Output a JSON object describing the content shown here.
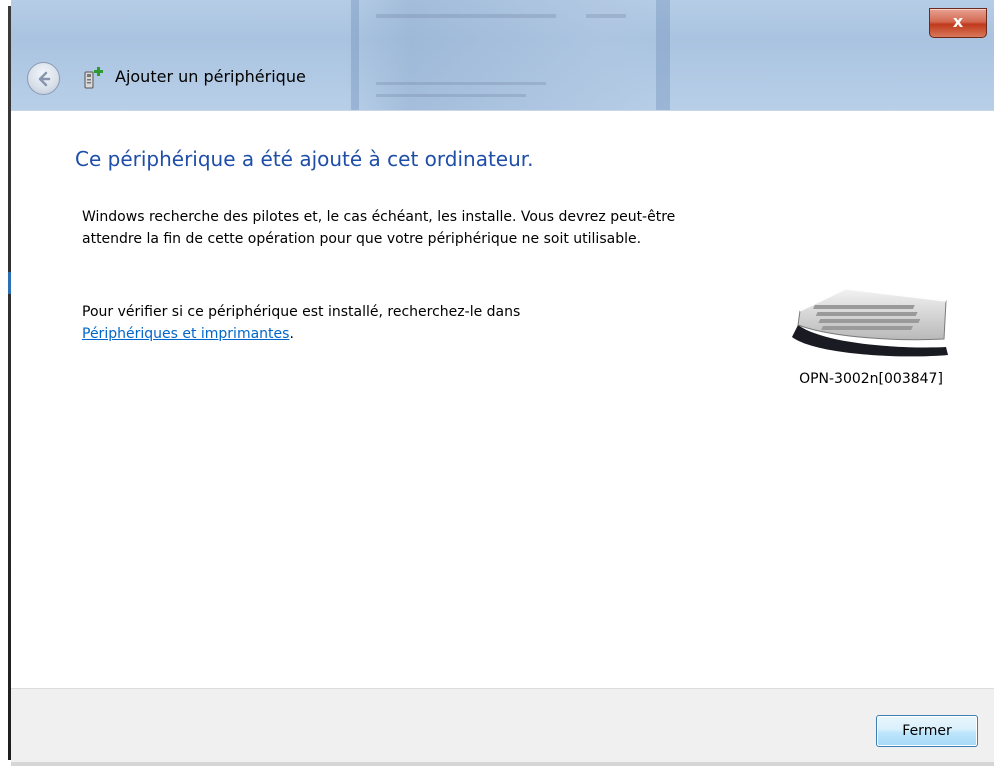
{
  "window": {
    "title": "Ajouter un périphérique",
    "close_glyph": "x"
  },
  "content": {
    "heading": "Ce périphérique a été ajouté à cet ordinateur.",
    "paragraph1": "Windows recherche des pilotes et, le cas échéant, les installe. Vous devrez peut-être attendre la fin de cette opération pour que votre périphérique ne soit utilisable.",
    "paragraph2_prefix": "Pour vérifier si ce périphérique est installé, recherchez-le dans",
    "paragraph2_link": "Périphériques et imprimantes",
    "paragraph2_suffix": ".",
    "device_name": "OPN-3002n[003847]",
    "device_icon": "keyboard-icon"
  },
  "footer": {
    "close_button_label": "Fermer"
  },
  "icons": {
    "back": "back-arrow-icon",
    "add_device": "add-device-icon",
    "close": "close-icon"
  },
  "colors": {
    "heading": "#1e4ea8",
    "link": "#0066cc",
    "close_button": "#c0391c",
    "footer_bg": "#f0f0f0"
  }
}
